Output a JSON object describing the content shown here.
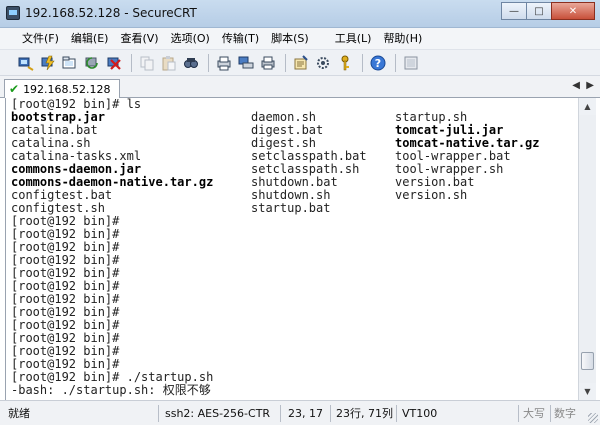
{
  "window": {
    "title": "192.168.52.128 - SecureCRT"
  },
  "menu": [
    "文件(F)",
    "编辑(E)",
    "查看(V)",
    "选项(O)",
    "传输(T)",
    "脚本(S)",
    "工具(L)",
    "帮助(H)"
  ],
  "toolbar_icons": [
    "connect-icon",
    "quick-connect-icon",
    "connect-tab-icon",
    "reconnect-icon",
    "disconnect-icon",
    "copy-icon",
    "paste-icon",
    "find-icon",
    "print-setup-icon",
    "print-screen-icon",
    "print-icon",
    "session-options-icon",
    "global-options-icon",
    "keymap-icon",
    "help-icon",
    "sftp-icon"
  ],
  "tab": {
    "label": "192.168.52.128",
    "status": "connected"
  },
  "terminal": {
    "prompt_ls": "[root@192 bin]# ls",
    "ls_rows": [
      [
        {
          "t": "bootstrap.jar",
          "b": true
        },
        {
          "t": "daemon.sh",
          "b": false
        },
        {
          "t": "startup.sh",
          "b": false
        }
      ],
      [
        {
          "t": "catalina.bat",
          "b": false
        },
        {
          "t": "digest.bat",
          "b": false
        },
        {
          "t": "tomcat-juli.jar",
          "b": true
        }
      ],
      [
        {
          "t": "catalina.sh",
          "b": false
        },
        {
          "t": "digest.sh",
          "b": false
        },
        {
          "t": "tomcat-native.tar.gz",
          "b": true
        }
      ],
      [
        {
          "t": "catalina-tasks.xml",
          "b": false
        },
        {
          "t": "setclasspath.bat",
          "b": false
        },
        {
          "t": "tool-wrapper.bat",
          "b": false
        }
      ],
      [
        {
          "t": "commons-daemon.jar",
          "b": true
        },
        {
          "t": "setclasspath.sh",
          "b": false
        },
        {
          "t": "tool-wrapper.sh",
          "b": false
        }
      ],
      [
        {
          "t": "commons-daemon-native.tar.gz",
          "b": true
        },
        {
          "t": "shutdown.bat",
          "b": false
        },
        {
          "t": "version.bat",
          "b": false
        }
      ],
      [
        {
          "t": "configtest.bat",
          "b": false
        },
        {
          "t": "shutdown.sh",
          "b": false
        },
        {
          "t": "version.sh",
          "b": false
        }
      ],
      [
        {
          "t": "configtest.sh",
          "b": false
        },
        {
          "t": "startup.bat",
          "b": false
        },
        {
          "t": "",
          "b": false
        }
      ]
    ],
    "empty_prompts": [
      "[root@192 bin]#",
      "[root@192 bin]#",
      "[root@192 bin]#",
      "[root@192 bin]#",
      "[root@192 bin]#",
      "[root@192 bin]#",
      "[root@192 bin]#",
      "[root@192 bin]#",
      "[root@192 bin]#",
      "[root@192 bin]#",
      "[root@192 bin]#",
      "[root@192 bin]#"
    ],
    "command_line": "[root@192 bin]# ./startup.sh",
    "error_line": "-bash: ./startup.sh: 权限不够"
  },
  "statusbar": {
    "ready": "就绪",
    "cipher": "ssh2: AES-256-CTR",
    "cursor": "23, 17",
    "size": "23行, 71列",
    "emulation": "VT100",
    "caps": "大写",
    "num": "数字"
  }
}
